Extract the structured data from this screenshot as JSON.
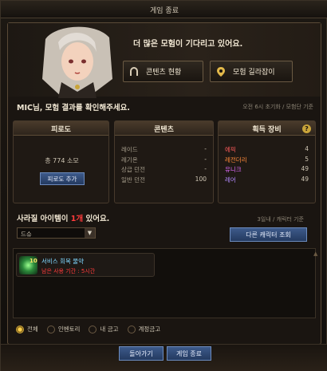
{
  "window": {
    "title": "게임 종료"
  },
  "hero": {
    "headline": "더 많은 모험이 기다리고 있어요.",
    "buttons": [
      {
        "label": "콘텐츠 현황",
        "icon": "horseshoe-icon"
      },
      {
        "label": "모험 길라잡이",
        "icon": "map-pin-icon"
      }
    ]
  },
  "summary": {
    "prompt": "MIC님, 모험 결과를 확인해주세요.",
    "reset_note": "오전 6시 초기화 / 모험단 기준"
  },
  "fatigue": {
    "title": "피로도",
    "value_text": "총 774 소모",
    "add_button": "피로도 추가"
  },
  "contents": {
    "title": "콘텐츠",
    "rows": [
      {
        "label": "레이드",
        "value": "-"
      },
      {
        "label": "레기온",
        "value": "-"
      },
      {
        "label": "상급 던전",
        "value": "-"
      },
      {
        "label": "일반 던전",
        "value": "100"
      }
    ]
  },
  "equipment": {
    "title": "획득 장비",
    "help": "?",
    "rows": [
      {
        "label": "에픽",
        "value": "4",
        "color": "#ff5b5b"
      },
      {
        "label": "레전더리",
        "value": "5",
        "color": "#ff8a3a"
      },
      {
        "label": "유니크",
        "value": "49",
        "color": "#e26bff"
      },
      {
        "label": "레어",
        "value": "49",
        "color": "#b38aff"
      }
    ]
  },
  "items": {
    "line_prefix": "사라질 아이템이 ",
    "count": "1개",
    "line_suffix": " 있어요.",
    "char_note": "3일내 / 캐릭터 기준",
    "dropdown_value": "드슈",
    "other_char_button": "다른 캐릭터 조회",
    "list": [
      {
        "level": "10",
        "name": "서비스 회복 물약",
        "expire": "남은 사용 기간 : 5시간"
      }
    ]
  },
  "filters": [
    {
      "label": "전체",
      "selected": true
    },
    {
      "label": "인벤토리",
      "selected": false
    },
    {
      "label": "내 금고",
      "selected": false
    },
    {
      "label": "계정금고",
      "selected": false
    }
  ],
  "footer": {
    "back_label": "돌아가기",
    "end_label": "게임 종료"
  }
}
